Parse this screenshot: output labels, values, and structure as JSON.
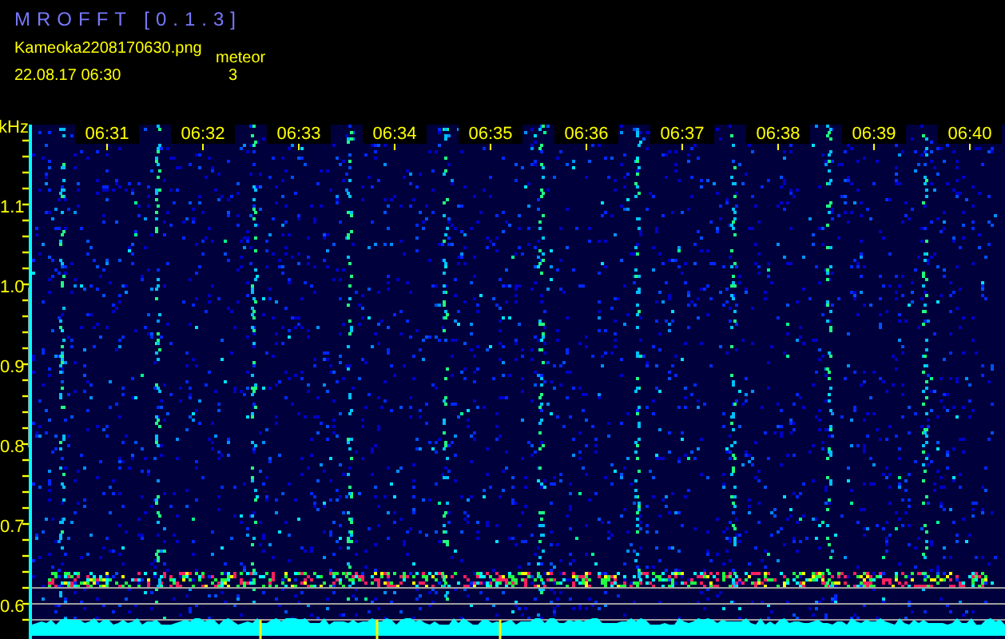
{
  "app_title": "MROFFT [0.1.3]",
  "file_name": "Kameoka2208170630.png",
  "count_label": "meteor",
  "start_time": "22.08.17 06:30",
  "count": "3",
  "unit_label": "kHz",
  "frequency_labels": [
    "1.1",
    "1.0",
    "0.9",
    "0.8",
    "0.7",
    "0.6"
  ],
  "time_labels": [
    "06:31",
    "06:32",
    "06:33",
    "06:34",
    "06:35",
    "06:36",
    "06:37",
    "06:38",
    "06:39",
    "06:40"
  ]
}
